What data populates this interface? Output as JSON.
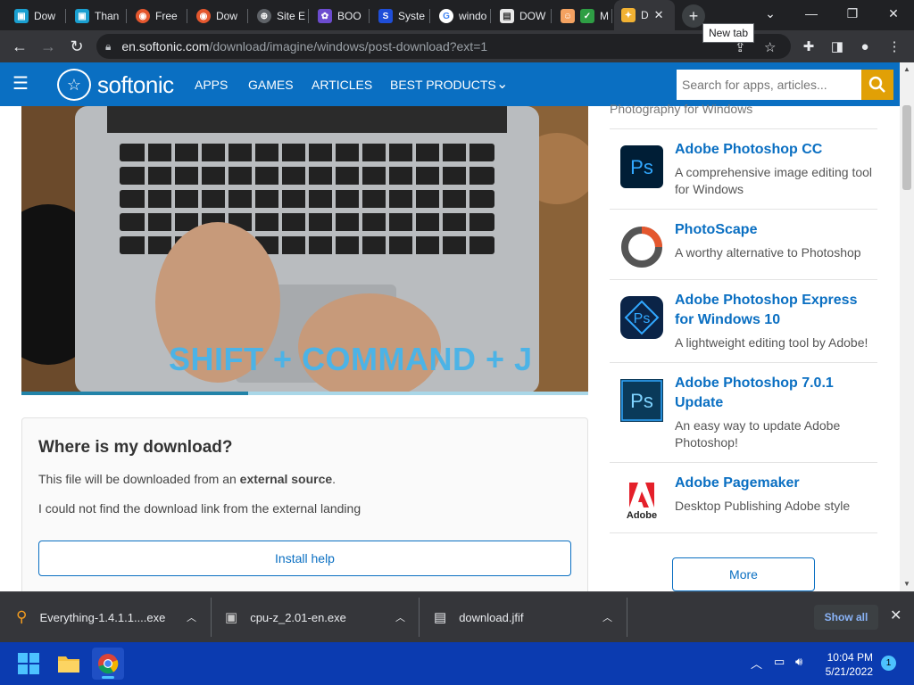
{
  "browser": {
    "tabs": [
      {
        "label": "Dow",
        "fav_color": "#1a9fd0"
      },
      {
        "label": "Than",
        "fav_color": "#1a9fd0"
      },
      {
        "label": "Free",
        "fav_color": "#e4572e"
      },
      {
        "label": "Dow",
        "fav_color": "#e4572e"
      },
      {
        "label": "Site E",
        "fav_color": "#9aa0a6"
      },
      {
        "label": "BOO",
        "fav_color": "#6c4ccf"
      },
      {
        "label": "Syste",
        "fav_color": "#1f4ed8"
      },
      {
        "label": "windo",
        "fav_color": "#ffffff"
      },
      {
        "label": "DOW",
        "fav_color": "#e8e8e8"
      },
      {
        "label": "M",
        "fav_color": "#2e9e44"
      },
      {
        "label": "D",
        "fav_color": "#f2b233"
      }
    ],
    "new_tab_tooltip": "New tab",
    "url_host": "en.softonic.com",
    "url_path": "/download/imagine/windows/post-download?ext=1"
  },
  "site": {
    "logo_text": "softonic",
    "nav": [
      "APPS",
      "GAMES",
      "ARTICLES",
      "BEST PRODUCTS"
    ],
    "search_placeholder": "Search for apps, articles...",
    "hero_caption": "SHIFT + COMMAND + J",
    "hero_progress": 0.4,
    "download_card": {
      "title": "Where is my download?",
      "line1_prefix": "This file will be downloaded from an ",
      "line1_bold": "external source",
      "line1_suffix": ".",
      "line2": "I could not find the download link from the external landing",
      "install_label": "Install help"
    },
    "sidebar": {
      "top_text": "Photography for Windows",
      "items": [
        {
          "name": "Adobe Photoshop CC",
          "desc": "A comprehensive image editing tool for Windows",
          "icon": "photoshop-cc-icon"
        },
        {
          "name": "PhotoScape",
          "desc": "A worthy alternative to Photoshop",
          "icon": "photoscape-icon"
        },
        {
          "name": "Adobe Photoshop Express for Windows 10",
          "desc": "A lightweight editing tool by Adobe!",
          "icon": "photoshop-express-icon"
        },
        {
          "name": "Adobe Photoshop 7.0.1 Update",
          "desc": "An easy way to update Adobe Photoshop!",
          "icon": "photoshop-7-icon"
        },
        {
          "name": "Adobe Pagemaker",
          "desc": "Desktop Publishing Adobe style",
          "icon": "adobe-pagemaker-icon",
          "icon_text": "Adobe"
        }
      ],
      "more_label": "More"
    }
  },
  "downloads": {
    "items": [
      {
        "name": "Everything-1.4.1.1....exe"
      },
      {
        "name": "cpu-z_2.01-en.exe"
      },
      {
        "name": "download.jfif"
      }
    ],
    "show_all": "Show all"
  },
  "taskbar": {
    "time": "10:04 PM",
    "date": "5/21/2022",
    "notifications": "1"
  }
}
